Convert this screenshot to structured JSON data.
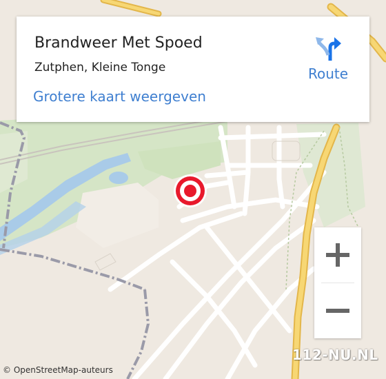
{
  "card": {
    "title": "Brandweer Met Spoed",
    "address": "Zutphen, Kleine Tonge",
    "larger_map_link": "Grotere kaart weergeven",
    "route_label": "Route"
  },
  "map": {
    "zoom_in_symbol": "+",
    "zoom_out_symbol": "−",
    "attribution": "© OpenStreetMap-auteurs",
    "watermark": "112-NU.NL",
    "marker_icon": "target-marker-icon",
    "colors": {
      "background": "#efe9e1",
      "greenery": "#d4e4c4",
      "water": "#a9cbe8",
      "road_major": "#f5c95a",
      "road_minor": "#ffffff",
      "boundary": "#9a9aa8",
      "marker": "#e8192c",
      "link": "#3f7fd0"
    }
  }
}
